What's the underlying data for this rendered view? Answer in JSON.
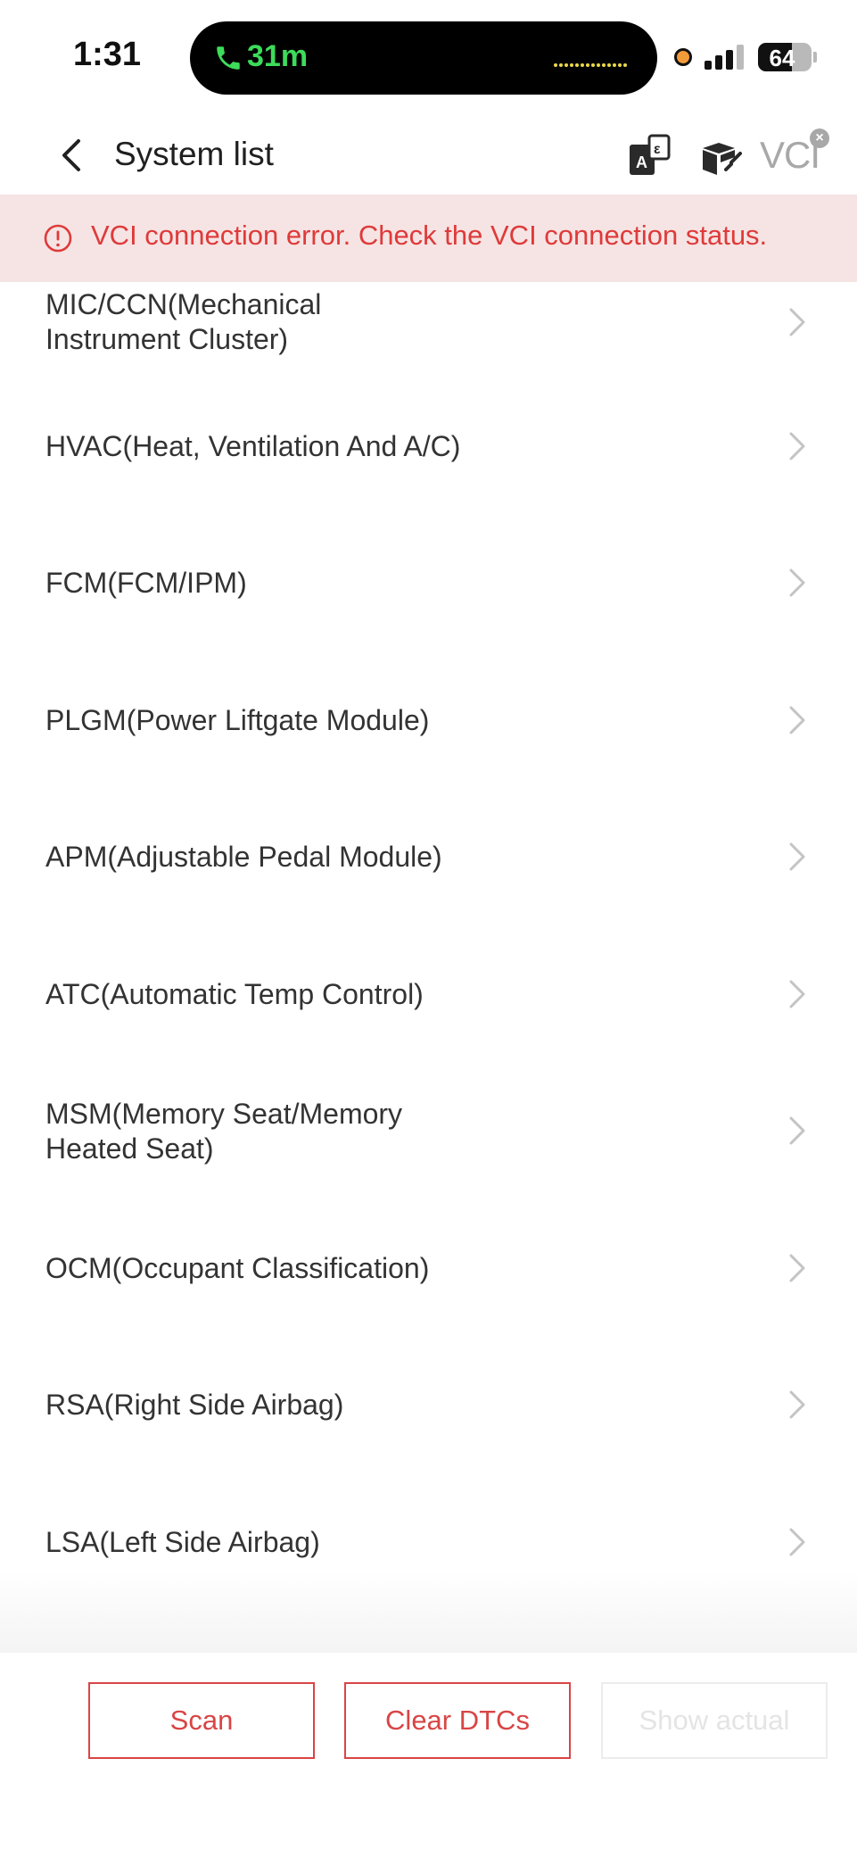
{
  "status_bar": {
    "time": "1:31",
    "call_duration": "31m",
    "battery_level": "64",
    "battery_fraction": 0.64
  },
  "header": {
    "title": "System list",
    "vci_label": "VCI",
    "icons": [
      "back-arrow-icon",
      "translate-icon",
      "vehicle-box-icon",
      "vci-disconnected-icon"
    ]
  },
  "error_banner": {
    "message": "VCI connection error. Check the VCI connection status."
  },
  "system_list": {
    "items": [
      {
        "line1": "MIC/CCN(Mechanical",
        "line2": "Instrument Cluster)"
      },
      {
        "line1": "HVAC(Heat, Ventilation And A/C)",
        "line2": ""
      },
      {
        "line1": "FCM(FCM/IPM)",
        "line2": ""
      },
      {
        "line1": "PLGM(Power Liftgate Module)",
        "line2": ""
      },
      {
        "line1": "APM(Adjustable Pedal Module)",
        "line2": ""
      },
      {
        "line1": "ATC(Automatic Temp Control)",
        "line2": ""
      },
      {
        "line1": "MSM(Memory Seat/Memory",
        "line2": "Heated Seat)"
      },
      {
        "line1": "OCM(Occupant Classification)",
        "line2": ""
      },
      {
        "line1": "RSA(Right Side Airbag)",
        "line2": ""
      },
      {
        "line1": "LSA(Left Side Airbag)",
        "line2": ""
      }
    ]
  },
  "bottom_bar": {
    "scan_label": "Scan",
    "clear_dtcs_label": "Clear DTCs",
    "show_actual_label": "Show actual"
  },
  "colors": {
    "accent_red": "#d94545",
    "error_text": "#df3a3a",
    "error_background": "#f6e4e4",
    "call_green": "#3ddc5a"
  }
}
